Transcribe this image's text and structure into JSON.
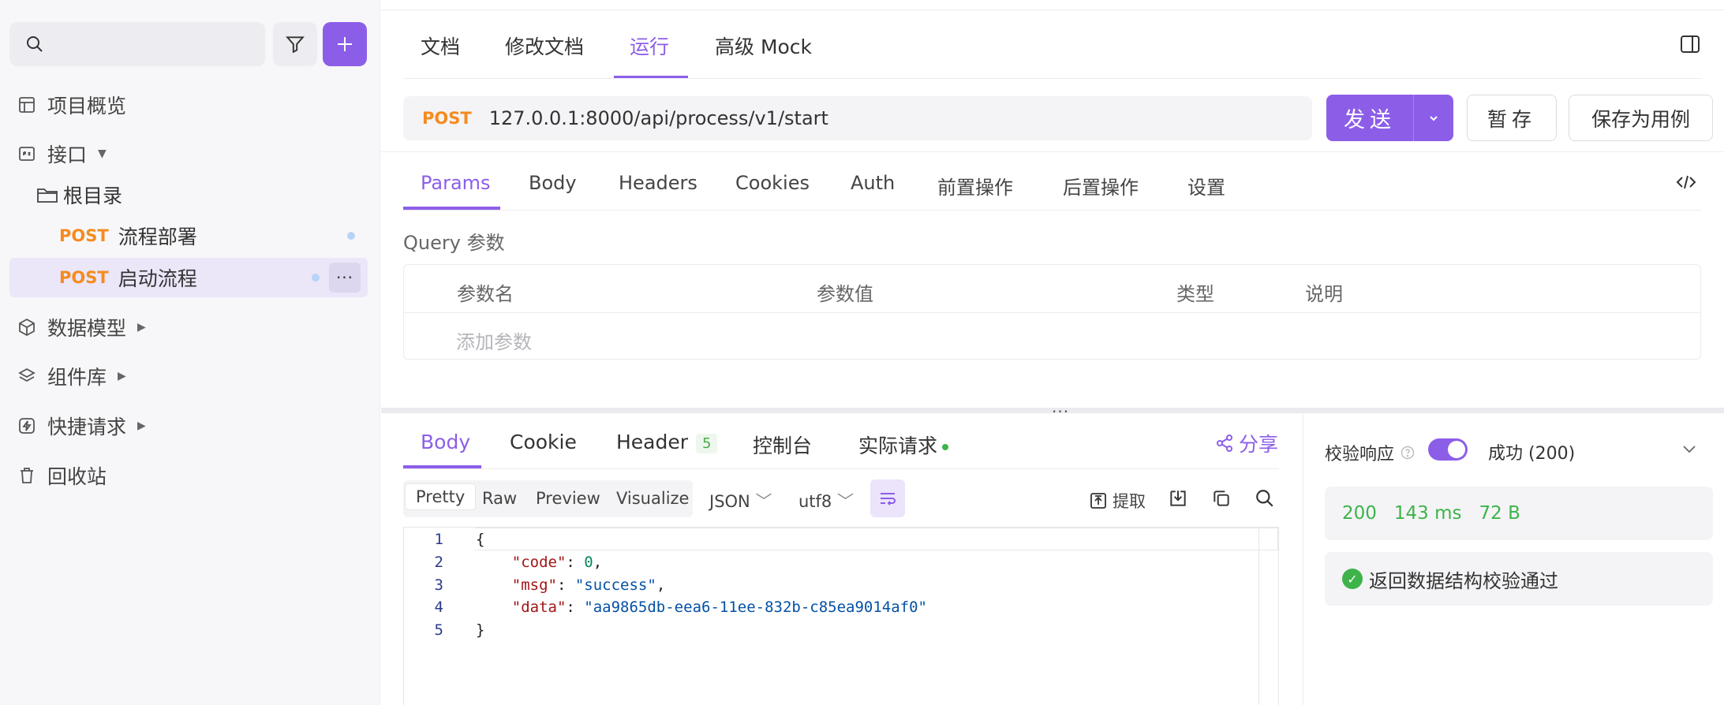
{
  "sidebar": {
    "nav": {
      "overview": "项目概览",
      "interfaces": "接口",
      "data_models": "数据模型",
      "components": "组件库",
      "quick_requests": "快捷请求",
      "trash": "回收站"
    },
    "tree": {
      "root": "根目录",
      "items": [
        {
          "method": "POST",
          "name": "流程部署"
        },
        {
          "method": "POST",
          "name": "启动流程"
        }
      ]
    },
    "more_label": "···"
  },
  "tabs": {
    "doc": "文档",
    "edit_doc": "修改文档",
    "run": "运行",
    "mock": "高级 Mock"
  },
  "request": {
    "method": "POST",
    "url": "127.0.0.1:8000/api/process/v1/start",
    "send": "发送",
    "save_draft": "暂存",
    "save_case": "保存为用例"
  },
  "request_tabs": {
    "params": "Params",
    "body": "Body",
    "headers": "Headers",
    "cookies": "Cookies",
    "auth": "Auth",
    "pre": "前置操作",
    "post": "后置操作",
    "settings": "设置"
  },
  "query": {
    "title": "Query 参数",
    "col_name": "参数名",
    "col_value": "参数值",
    "col_type": "类型",
    "col_desc": "说明",
    "add_placeholder": "添加参数"
  },
  "grip": "···",
  "response_tabs": {
    "body": "Body",
    "cookie": "Cookie",
    "header": "Header",
    "header_count": "5",
    "console": "控制台",
    "actual": "实际请求",
    "share": "分享"
  },
  "format": {
    "pretty": "Pretty",
    "raw": "Raw",
    "preview": "Preview",
    "visualize": "Visualize",
    "type": "JSON",
    "encoding": "utf8",
    "extract": "提取"
  },
  "code_lines": [
    {
      "n": "1"
    },
    {
      "n": "2"
    },
    {
      "n": "3"
    },
    {
      "n": "4"
    },
    {
      "n": "5"
    }
  ],
  "response_json": {
    "code_key": "\"code\"",
    "code_val": "0",
    "msg_key": "\"msg\"",
    "msg_val": "\"success\"",
    "data_key": "\"data\"",
    "data_val": "\"aa9865db-eea6-11ee-832b-c85ea9014af0\""
  },
  "validation": {
    "label": "校验响应",
    "status_option": "成功 (200)",
    "status_code": "200",
    "time": "143 ms",
    "size": "72 B",
    "result": "返回数据结构校验通过"
  },
  "colors": {
    "accent": "#8c5ee8",
    "post": "#f58b1f",
    "success": "#3db34a"
  }
}
